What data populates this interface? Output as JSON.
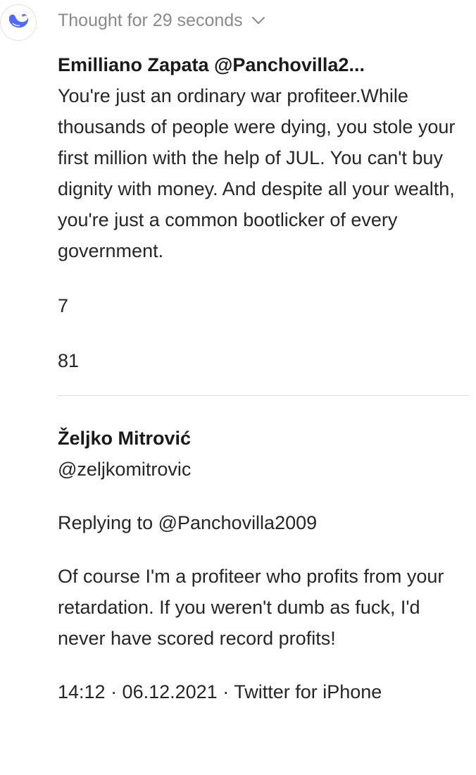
{
  "header": {
    "thought_label": "Thought for 29 seconds",
    "chevron_icon": "chevron-down-icon",
    "avatar_icon": "whale-logo-icon",
    "accent_color": "#4d6bfe"
  },
  "tweet": {
    "author_line": "Emilliano Zapata @Panchovilla2...",
    "body": "You're just an ordinary war profiteer.While thousands of people were dying, you stole your first million with the help of JUL. You can't buy dignity with money. And despite all your wealth, you're just a common bootlicker of every government.",
    "count_a": "7",
    "count_b": "81"
  },
  "reply": {
    "author_name": "Željko Mitrović",
    "handle": "@zeljkomitrovic",
    "replying_to": "Replying to @Panchovilla2009",
    "body": "Of course I'm a profiteer who profits from your retardation. If you weren't dumb as fuck, I'd never have scored record profits!",
    "meta": "14:12 · 06.12.2021 · Twitter for iPhone"
  }
}
